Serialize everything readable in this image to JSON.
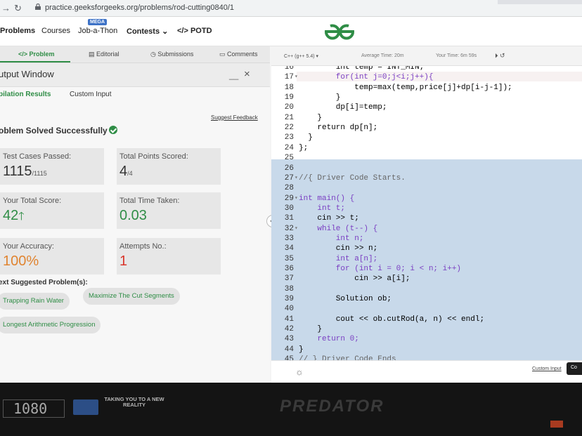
{
  "browser": {
    "url": "practice.geeksforgeeks.org/problems/rod-cutting0840/1"
  },
  "site_header": {
    "nav": [
      "Problems",
      "Courses",
      "Job-a-Thon",
      "Contests",
      "POTD"
    ],
    "mega_badge": "MEGA",
    "contests_chevron": "⌄",
    "potd_icon": "</>",
    "logo_icon": "gfg-logo-icon"
  },
  "problem_tabs": {
    "problem": "Problem",
    "problem_icon": "</>",
    "editorial": "Editorial",
    "submissions": "Submissions",
    "comments": "Comments"
  },
  "output_window": {
    "title": "utput Window",
    "minimize": "__",
    "close": "×",
    "tabs": [
      "pilation Results",
      "Custom Input"
    ],
    "suggest_feedback": "Suggest Feedback",
    "status": "oblem Solved Successfully",
    "stats": {
      "test_cases_label": "Test Cases Passed:",
      "test_cases_value": "1115",
      "test_cases_total": "/1115",
      "points_label": "Total Points Scored:",
      "points_value": "4",
      "points_total": "/4",
      "score_label": "Your Total Score:",
      "score_value": "42",
      "score_arrow": "🡑",
      "time_label": "Total Time Taken:",
      "time_value": "0.03",
      "accuracy_label": "Your Accuracy:",
      "accuracy_value": "100%",
      "attempts_label": "Attempts No.:",
      "attempts_value": "1"
    },
    "suggested_heading": "ext Suggested Problem(s):",
    "suggested": [
      "Trapping Rain Water",
      "Maximize The Cut Segments",
      "Longest Arithmetic Progression"
    ]
  },
  "editor": {
    "language": "C++ (g++ 5.4)",
    "lang_chevron": "▾",
    "average_time": "Average Time: 20m",
    "your_time": "Your Time: 6m 59s",
    "timer_icons": "⏵ ↺",
    "lines": [
      {
        "n": "16",
        "fold": "",
        "code": "        int temp = INT_MIN;",
        "kw": false
      },
      {
        "n": "17",
        "fold": "▾",
        "code": "        for(int j=0;j<i;j++){",
        "kw": true
      },
      {
        "n": "18",
        "fold": "",
        "code": "            temp=max(temp,price[j]+dp[i-j-1]);",
        "kw": false
      },
      {
        "n": "19",
        "fold": "",
        "code": "        }",
        "kw": false
      },
      {
        "n": "20",
        "fold": "",
        "code": "        dp[i]=temp;",
        "kw": false
      },
      {
        "n": "21",
        "fold": "",
        "code": "    }",
        "kw": false
      },
      {
        "n": "22",
        "fold": "",
        "code": "    return dp[n];",
        "kw": false
      },
      {
        "n": "23",
        "fold": "",
        "code": "  }",
        "kw": false
      },
      {
        "n": "24",
        "fold": "",
        "code": "};",
        "kw": false
      },
      {
        "n": "25",
        "fold": "",
        "code": "",
        "kw": false
      },
      {
        "n": "26",
        "fold": "",
        "code": "",
        "kw": false
      },
      {
        "n": "27",
        "fold": "▾",
        "code": "//{ Driver Code Starts.",
        "kw": false,
        "comment": true
      },
      {
        "n": "28",
        "fold": "",
        "code": "",
        "kw": false
      },
      {
        "n": "29",
        "fold": "▾",
        "code": "int main() {",
        "kw": true
      },
      {
        "n": "30",
        "fold": "",
        "code": "    int t;",
        "kw": true
      },
      {
        "n": "31",
        "fold": "",
        "code": "    cin >> t;",
        "kw": false
      },
      {
        "n": "32",
        "fold": "▾",
        "code": "    while (t--) {",
        "kw": true
      },
      {
        "n": "33",
        "fold": "",
        "code": "        int n;",
        "kw": true
      },
      {
        "n": "34",
        "fold": "",
        "code": "        cin >> n;",
        "kw": false
      },
      {
        "n": "35",
        "fold": "",
        "code": "        int a[n];",
        "kw": true
      },
      {
        "n": "36",
        "fold": "",
        "code": "        for (int i = 0; i < n; i++)",
        "kw": true
      },
      {
        "n": "37",
        "fold": "",
        "code": "            cin >> a[i];",
        "kw": false
      },
      {
        "n": "38",
        "fold": "",
        "code": "",
        "kw": false
      },
      {
        "n": "39",
        "fold": "",
        "code": "        Solution ob;",
        "kw": false
      },
      {
        "n": "40",
        "fold": "",
        "code": "",
        "kw": false
      },
      {
        "n": "41",
        "fold": "",
        "code": "        cout << ob.cutRod(a, n) << endl;",
        "kw": false
      },
      {
        "n": "42",
        "fold": "",
        "code": "    }",
        "kw": false
      },
      {
        "n": "43",
        "fold": "",
        "code": "    return 0;",
        "kw": true
      },
      {
        "n": "44",
        "fold": "",
        "code": "}",
        "kw": false
      },
      {
        "n": "45",
        "fold": "",
        "code": "// } Driver Code Ends",
        "kw": false,
        "comment": true
      }
    ],
    "custom_input": "Custom Input",
    "compile_button": "Co",
    "bulb_icon": "☼"
  },
  "bezel": {
    "resolution": "1080",
    "promo": "TAKING YOU TO A NEW REALITY",
    "brand": "PREDATOR"
  }
}
